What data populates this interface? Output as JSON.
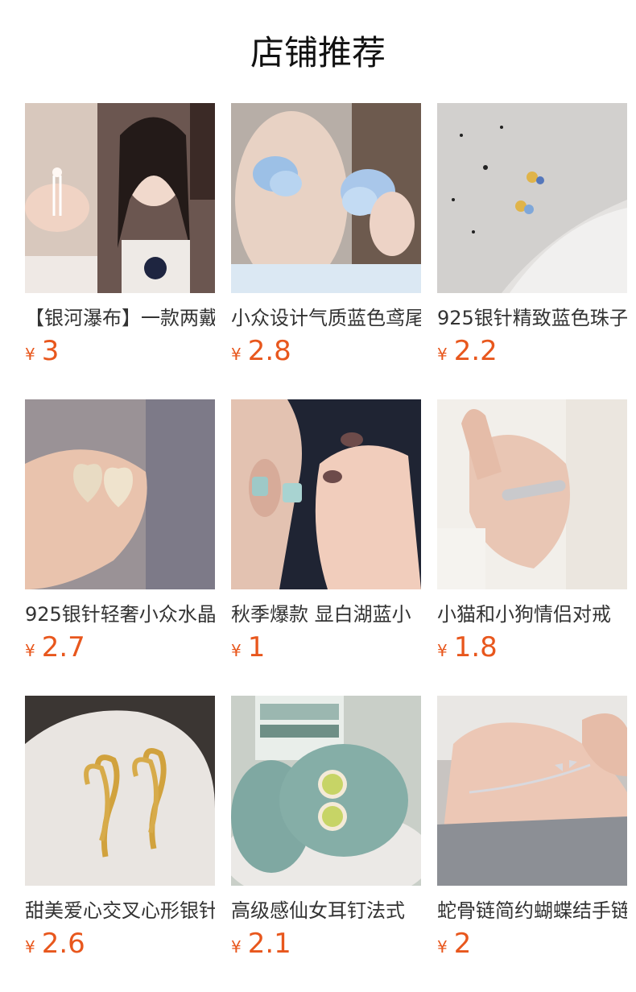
{
  "header": {
    "title": "店铺推荐"
  },
  "products": [
    {
      "name": "【银河瀑布】一款两戴",
      "currency": "¥",
      "price": "3",
      "image": "tassel-earrings-photo"
    },
    {
      "name": "小众设计气质蓝色鸢尾",
      "currency": "¥",
      "price": "2.8",
      "image": "blue-flower-earrings-photo"
    },
    {
      "name": "925银针精致蓝色珠子",
      "currency": "¥",
      "price": "2.2",
      "image": "blue-bead-earrings-photo"
    },
    {
      "name": "925银针轻奢小众水晶",
      "currency": "¥",
      "price": "2.7",
      "image": "heart-crystal-earrings-photo"
    },
    {
      "name": "秋季爆款 显白湖蓝小",
      "currency": "¥",
      "price": "1",
      "image": "lake-blue-earrings-photo"
    },
    {
      "name": "小猫和小狗情侣对戒",
      "currency": "¥",
      "price": "1.8",
      "image": "couple-ring-photo"
    },
    {
      "name": "甜美爱心交叉心形银针",
      "currency": "¥",
      "price": "2.6",
      "image": "gold-heart-earrings-photo"
    },
    {
      "name": "高级感仙女耳钉法式",
      "currency": "¥",
      "price": "2.1",
      "image": "cat-eye-stud-photo"
    },
    {
      "name": "蛇骨链简约蝴蝶结手链",
      "currency": "¥",
      "price": "2",
      "image": "bow-bracelet-photo"
    }
  ]
}
